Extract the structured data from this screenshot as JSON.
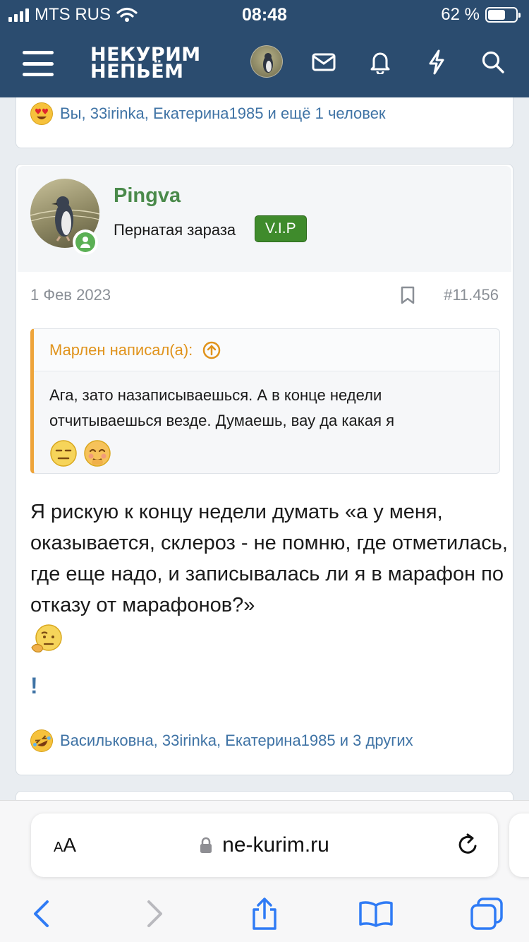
{
  "status": {
    "carrier": "MTS RUS",
    "time": "08:48",
    "battery_percent": "62 %",
    "battery_level": 0.62
  },
  "header": {
    "logo_line1": "НЕКУРИМ",
    "logo_line2": "НЕПЬЁМ",
    "icons": [
      "menu-icon",
      "avatar",
      "mail-icon",
      "bell-icon",
      "bolt-icon",
      "search-icon"
    ]
  },
  "prev_post": {
    "reactions_text": "Вы, 33irinka, Екатерина1985 и ещё 1 человек",
    "reaction_icon": "heart-eyes-emoji"
  },
  "post": {
    "username": "Pingva",
    "user_title": "Пернатая зараза",
    "badge": "V.I.P",
    "date": "1 Фев 2023",
    "post_number": "#11.456",
    "quote": {
      "author": "Марлен написал(а):",
      "text": "Ага, зато назаписываешься. А в конце недели отчитываешься везде. Думаешь, вау да какая я"
    },
    "body": "Я рискую к концу недели думать «а у меня, оказывается, склероз - не помню, где отметилась, где еще надо, и записывалась ли я в марафон по отказу от марафонов?»",
    "exclamation": "!",
    "reactions_text": "Васильковна, 33irinka, Екатерина1985 и 3 других",
    "reaction_icon": "rofl-emoji"
  },
  "browser": {
    "aa_label": "AA",
    "url": "ne-kurim.ru",
    "toolbar": [
      "back-icon",
      "forward-icon",
      "share-icon",
      "bookmarks-icon",
      "tabs-icon"
    ]
  },
  "colors": {
    "header_bg": "#2b4c6f",
    "username": "#4a8a4b",
    "badge": "#3f8b2c",
    "quote_accent": "#eea43a",
    "link": "#3f73a5",
    "safari_blue": "#2f7bf5"
  }
}
